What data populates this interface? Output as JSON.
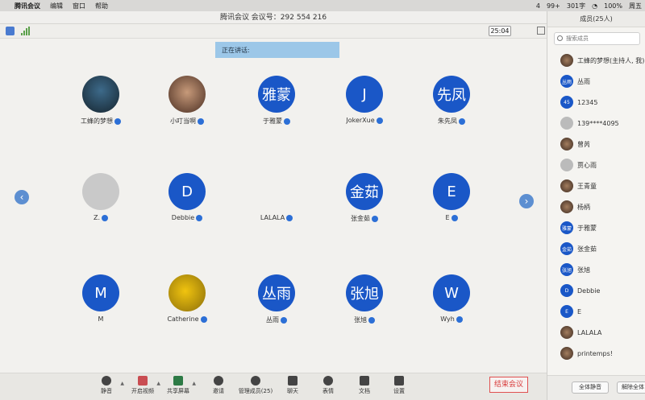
{
  "menubar": {
    "app": "腾讯会议",
    "items": [
      "编辑",
      "窗口",
      "帮助"
    ],
    "status": {
      "battery": "100%",
      "notify_count": "4",
      "wechat_badge": "99+",
      "temp": "301字",
      "day": "周五"
    }
  },
  "window": {
    "title": "腾讯会议  会议号：292 554 216"
  },
  "meeting": {
    "timer": "25:04",
    "speaking_label": "正在讲话:"
  },
  "participants": [
    {
      "name": "工蜂的梦想",
      "initials": "",
      "kind": "photo1"
    },
    {
      "name": "小叮当啊",
      "initials": "",
      "kind": "photo2"
    },
    {
      "name": "于雅蒙",
      "initials": "雅蒙",
      "kind": "blue"
    },
    {
      "name": "JokerXue",
      "initials": "J",
      "kind": "blue"
    },
    {
      "name": "朱先凤",
      "initials": "先凤",
      "kind": "blue"
    },
    {
      "name": "Z.",
      "initials": "",
      "kind": "gray"
    },
    {
      "name": "Debbie",
      "initials": "D",
      "kind": "blue"
    },
    {
      "name": "LALALA",
      "initials": "",
      "kind": "cartoon"
    },
    {
      "name": "张金茹",
      "initials": "金茹",
      "kind": "blue"
    },
    {
      "name": "E",
      "initials": "E",
      "kind": "blue"
    },
    {
      "name": "M",
      "initials": "M",
      "kind": "blue"
    },
    {
      "name": "Catherine",
      "initials": "",
      "kind": "yellow"
    },
    {
      "name": "丛雨",
      "initials": "丛雨",
      "kind": "blue"
    },
    {
      "name": "张旭",
      "initials": "张旭",
      "kind": "blue"
    },
    {
      "name": "Wyh",
      "initials": "W",
      "kind": "blue"
    }
  ],
  "toolbar": {
    "mute": "静音",
    "video": "开启视频",
    "share": "共享屏幕",
    "invite": "邀请",
    "members": "管理成员(25)",
    "chat": "聊天",
    "reaction": "表情",
    "docs": "文档",
    "settings": "设置",
    "end": "结束会议"
  },
  "panel": {
    "title": "成员(25人)",
    "search_placeholder": "搜索成员",
    "members": [
      {
        "name": "工蜂的梦想(主持人, 我)",
        "initials": "",
        "kind": "p"
      },
      {
        "name": "丛雨",
        "initials": "丛雨",
        "kind": "b"
      },
      {
        "name": "12345",
        "initials": "45",
        "kind": "b"
      },
      {
        "name": "139****4095",
        "initials": "",
        "kind": "g"
      },
      {
        "name": "曾芮",
        "initials": "",
        "kind": "p"
      },
      {
        "name": "贾心雨",
        "initials": "",
        "kind": "g"
      },
      {
        "name": "王青童",
        "initials": "",
        "kind": "p"
      },
      {
        "name": "杨柄",
        "initials": "",
        "kind": "p"
      },
      {
        "name": "于雅蒙",
        "initials": "雅蒙",
        "kind": "b"
      },
      {
        "name": "张金茹",
        "initials": "金茹",
        "kind": "b"
      },
      {
        "name": "张旭",
        "initials": "张旭",
        "kind": "b"
      },
      {
        "name": "Debbie",
        "initials": "D",
        "kind": "b"
      },
      {
        "name": "E",
        "initials": "E",
        "kind": "b"
      },
      {
        "name": "LALALA",
        "initials": "",
        "kind": "p"
      },
      {
        "name": "printemps!",
        "initials": "",
        "kind": "p"
      }
    ],
    "mute_all": "全体静音",
    "unmute_all": "解除全体"
  }
}
